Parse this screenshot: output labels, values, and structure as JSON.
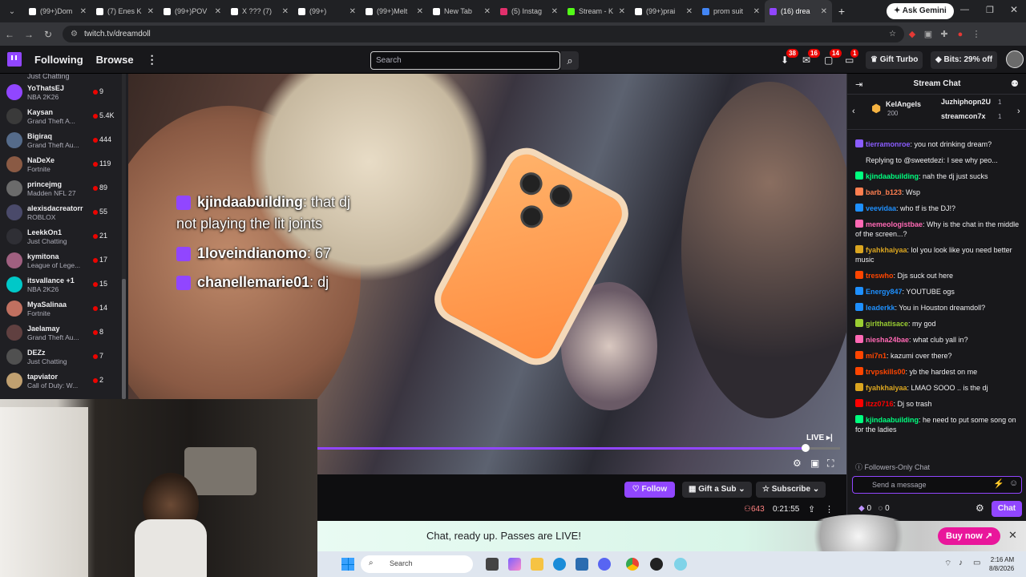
{
  "browser": {
    "tabs": [
      {
        "label": "(99+)Dom",
        "color": "#ffffff"
      },
      {
        "label": "(7) Enes K",
        "color": "#ffffff"
      },
      {
        "label": "(99+)POV",
        "color": "#ffffff"
      },
      {
        "label": "X ??? (7)",
        "color": "#ffffff"
      },
      {
        "label": "(99+)",
        "color": "#ffffff"
      },
      {
        "label": "(99+)Melt",
        "color": "#ffffff"
      },
      {
        "label": "New Tab",
        "color": "#ffffff"
      },
      {
        "label": "(5) Instag",
        "color": "#e1306c"
      },
      {
        "label": "Stream - K",
        "color": "#53fc18"
      },
      {
        "label": "(99+)prai",
        "color": "#ffffff"
      },
      {
        "label": "prom suit",
        "color": "#4285f4"
      },
      {
        "label": "(16) drea",
        "color": "#9146ff",
        "active": true
      }
    ],
    "new_tab_icon": "plus-icon",
    "ask_gemini": "Ask Gemini",
    "url": "twitch.tv/dreamdoll"
  },
  "nav": {
    "following": "Following",
    "browse": "Browse",
    "search_placeholder": "Search",
    "badges": [
      "38",
      "16",
      "14",
      "1"
    ],
    "gift_turbo": "Gift Turbo",
    "bits": "Bits: 29% off",
    "accent": "#9146ff"
  },
  "sidebar": {
    "top_game": "Just Chatting",
    "channels": [
      {
        "name": "YoThatsEJ",
        "game": "NBA 2K26",
        "viewers": "9"
      },
      {
        "name": "Kaysan",
        "game": "Grand Theft A...",
        "viewers": "5.4K"
      },
      {
        "name": "Bigiraq",
        "game": "Grand Theft Au...",
        "viewers": "444"
      },
      {
        "name": "NaDeXe",
        "game": "Fortnite",
        "viewers": "119"
      },
      {
        "name": "princejmg",
        "game": "Madden NFL 27",
        "viewers": "89"
      },
      {
        "name": "alexisdacreatorr",
        "game": "ROBLOX",
        "viewers": "55"
      },
      {
        "name": "LeekkOn1",
        "game": "Just Chatting",
        "viewers": "21"
      },
      {
        "name": "kymitona",
        "game": "League of Lege...",
        "viewers": "17"
      },
      {
        "name": "itsvallance +1",
        "game": "NBA 2K26",
        "viewers": "15"
      },
      {
        "name": "MyaSalinaa",
        "game": "Fortnite",
        "viewers": "14"
      },
      {
        "name": "Jaelamay",
        "game": "Grand Theft Au...",
        "viewers": "8"
      },
      {
        "name": "DEZz",
        "game": "Just Chatting",
        "viewers": "7"
      },
      {
        "name": "tapviator",
        "game": "Call of Duty: W...",
        "viewers": "2"
      }
    ]
  },
  "video": {
    "overlay_chat": [
      {
        "user": "kjindaabuilding",
        "text": ": that dj"
      },
      {
        "user": "",
        "text": "not playing the lit joints"
      },
      {
        "user": "1loveindianomo",
        "text": ": 67"
      },
      {
        "user": "chanellemarie01",
        "text": ": dj"
      }
    ],
    "live": "LIVE",
    "progress": 0.93
  },
  "channel": {
    "follow": "Follow",
    "gift_sub": "Gift a Sub",
    "subscribe": "Subscribe",
    "viewers": "643",
    "uptime": "0:21:55"
  },
  "banner": {
    "text": "Chat, ready up. Passes are LIVE!",
    "buy_now": "Buy now"
  },
  "chat": {
    "title": "Stream Chat",
    "leaders": [
      {
        "name": "KeIAngels",
        "sub": "200"
      },
      {
        "name": "Juzhiphopn2U",
        "sub": "1"
      },
      {
        "name": "streamcon7x",
        "sub": "1"
      }
    ],
    "messages": [
      {
        "user": "tierramonroe",
        "color": "#8a5cff",
        "text": ": you not drinking dream?"
      },
      {
        "user": "",
        "color": "#adadb8",
        "text": "Replying to @sweetdezi: I see why peo..."
      },
      {
        "user": "kjindaabuilding",
        "color": "#00ff7f",
        "text": ": nah the dj just sucks"
      },
      {
        "user": "barb_b123",
        "color": "#ff7f50",
        "text": ": Wsp"
      },
      {
        "user": "veevidaa",
        "color": "#1e90ff",
        "text": ": who tf is the DJ!?"
      },
      {
        "user": "memeologistbae",
        "color": "#ff69b4",
        "text": ": Why is the chat in the middle of the screen...?"
      },
      {
        "user": "fyahkhaiyaa",
        "color": "#daa520",
        "text": ": lol you look like you need better music"
      },
      {
        "user": "treswho",
        "color": "#ff4500",
        "text": ": Djs suck out here"
      },
      {
        "user": "Energy847",
        "color": "#1e90ff",
        "text": ": YOUTUBE ogs"
      },
      {
        "user": "leaderkk",
        "color": "#1e90ff",
        "text": ": You in Houston dreamdoll?"
      },
      {
        "user": "girlthatisace",
        "color": "#9acd32",
        "text": ": my god"
      },
      {
        "user": "niesha24bae",
        "color": "#ff69b4",
        "text": ": what club yall in?"
      },
      {
        "user": "mi7n1",
        "color": "#ff4500",
        "text": ": kazumi over there?"
      },
      {
        "user": "trvpskills00",
        "color": "#ff4500",
        "text": ": yb the hardest on me"
      },
      {
        "user": "fyahkhaiyaa",
        "color": "#daa520",
        "text": ": LMAO SOOO .. is the dj"
      },
      {
        "user": "itzz0716",
        "color": "#ff0000",
        "text": ": Dj so trash"
      },
      {
        "user": "kjindaabuilding",
        "color": "#00ff7f",
        "text": ": he need to put some song on for the ladies"
      }
    ],
    "followers_only": "Followers-Only Chat",
    "placeholder": "Send a message",
    "points_a": "0",
    "points_b": "0",
    "chat_btn": "Chat"
  },
  "taskbar": {
    "search": "Search",
    "time": "2:16 AM",
    "date": "8/8/2026"
  }
}
